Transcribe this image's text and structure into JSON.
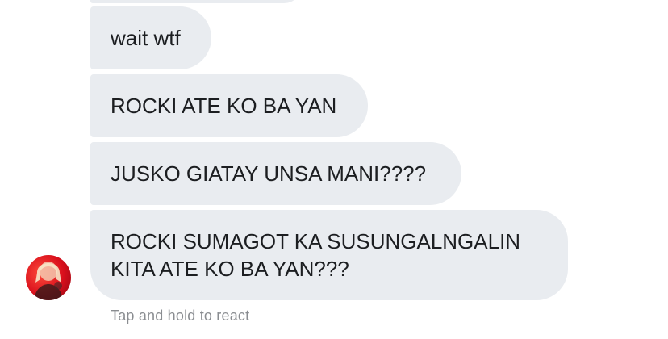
{
  "conversation": {
    "messages": [
      {
        "text": "wait wtf"
      },
      {
        "text": "ROCKI ATE KO BA YAN"
      },
      {
        "text": "JUSKO GIATAY UNSA MANI????"
      },
      {
        "lines": [
          "ROCKI SUMAGOT KA SUSUNGALNGALIN",
          "KITA ATE KO BA YAN???"
        ]
      }
    ],
    "hint": "Tap and hold to react"
  },
  "colors": {
    "bubble_bg": "#e9ecf0",
    "text": "#1c1e21",
    "hint_text": "#8a8d91",
    "avatar_accent": "#d80f1c"
  },
  "icons": {
    "avatar": "sender-profile-photo"
  }
}
